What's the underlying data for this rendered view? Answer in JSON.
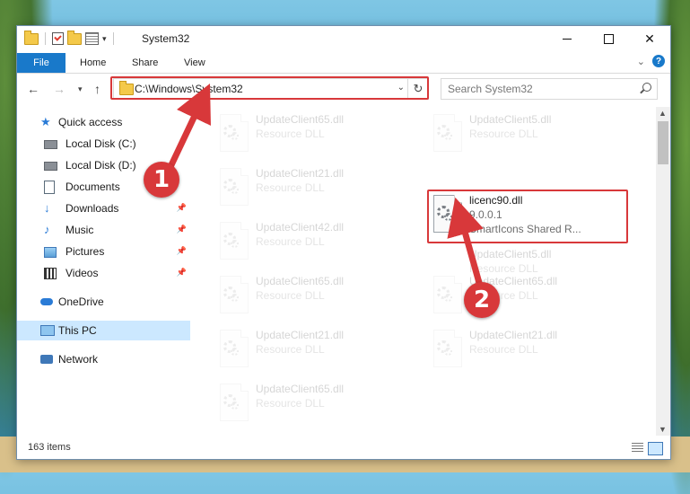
{
  "window": {
    "title": "System32",
    "controls": {
      "minimize": "",
      "maximize": "",
      "close": "✕"
    }
  },
  "ribbon": {
    "tabs": [
      "File",
      "Home",
      "Share",
      "View"
    ]
  },
  "address": {
    "path": "C:\\Windows\\System32",
    "search_placeholder": "Search System32"
  },
  "navpane": {
    "items": [
      {
        "label": "Quick access",
        "icon": "star-icon"
      },
      {
        "label": "Local Disk (C:)",
        "icon": "drive-icon"
      },
      {
        "label": "Local Disk (D:)",
        "icon": "drive-icon"
      },
      {
        "label": "Documents",
        "icon": "documents-icon"
      },
      {
        "label": "Downloads",
        "icon": "downloads-icon"
      },
      {
        "label": "Music",
        "icon": "music-icon"
      },
      {
        "label": "Pictures",
        "icon": "pictures-icon"
      },
      {
        "label": "Videos",
        "icon": "videos-icon"
      },
      {
        "label": "OneDrive",
        "icon": "onedrive-icon"
      },
      {
        "label": "This PC",
        "icon": "this-pc-icon"
      },
      {
        "label": "Network",
        "icon": "network-icon"
      }
    ]
  },
  "files": {
    "left_column": [
      {
        "name": "UpdateClient65.dll",
        "desc": "Resource DLL"
      },
      {
        "name": "UpdateClient21.dll",
        "desc": "Resource DLL"
      },
      {
        "name": "UpdateClient42.dll",
        "desc": "Resource DLL"
      },
      {
        "name": "UpdateClient65.dll",
        "desc": "Resource DLL"
      },
      {
        "name": "UpdateClient21.dll",
        "desc": "Resource DLL"
      },
      {
        "name": "UpdateClient65.dll",
        "desc": "Resource DLL"
      }
    ],
    "right_column": [
      {
        "name": "UpdateClient5.dll",
        "desc": "Resource DLL"
      },
      {
        "name": "UpdateClient5.dll",
        "desc": "Resource DLL"
      },
      {
        "name": "UpdateClient65.dll",
        "desc": "Resource DLL"
      },
      {
        "name": "UpdateClient21.dll",
        "desc": "Resource DLL"
      }
    ],
    "highlighted": {
      "name": "licenc90.dll",
      "version": "9.0.0.1",
      "desc": "SmartIcons Shared R..."
    }
  },
  "status": {
    "item_count": "163 items"
  },
  "annotations": {
    "step1": "1",
    "step2": "2",
    "color": "#d8383a"
  }
}
